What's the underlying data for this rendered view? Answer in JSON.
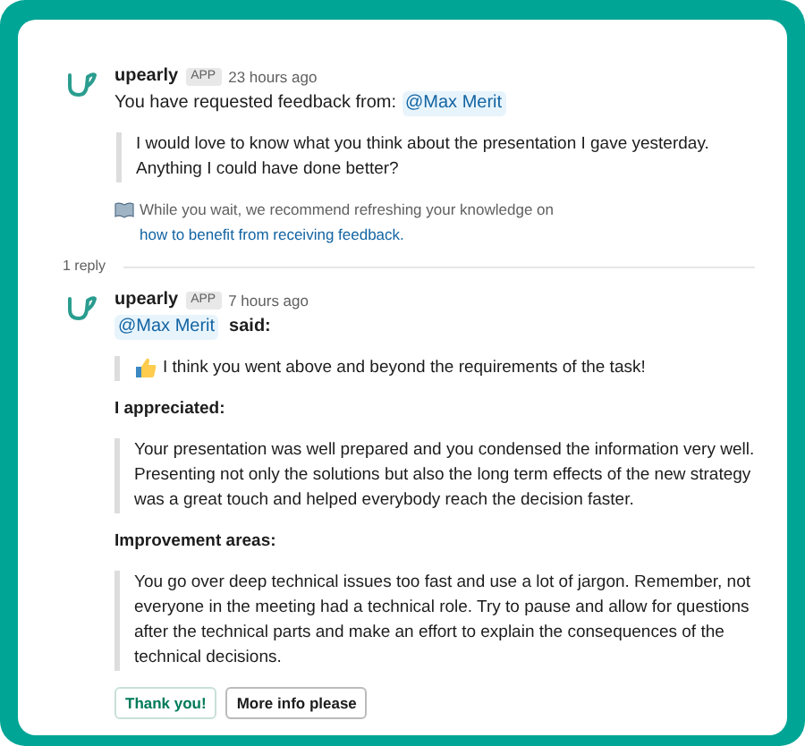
{
  "message": {
    "sender": "upearly",
    "badge": "APP",
    "time": "23 hours ago",
    "intro": "You have requested feedback from:",
    "mention": "@Max Merit",
    "quote": "I would love to know what you think about the presentation I gave yesterday. Anything I could have done better?",
    "tip": "While you wait, we recommend refreshing your knowledge on",
    "tip_link": "how to benefit from receiving feedback."
  },
  "replies_label": "1 reply",
  "reply": {
    "sender": "upearly",
    "badge": "APP",
    "time": "7 hours ago",
    "mention": "@Max Merit",
    "said": "said:",
    "blocks": [
      {
        "kind": "reaction_quote",
        "text": "I think you went above and beyond the requirements of the task!"
      },
      {
        "kind": "heading",
        "text": "I appreciated:"
      },
      {
        "kind": "quote",
        "text": "Your presentation was well prepared and you condensed the information very well. Presenting not only the solutions but also the long term effects of the new strategy was a great touch and helped everybody reach the decision faster."
      },
      {
        "kind": "heading",
        "text": "Improvement areas:"
      },
      {
        "kind": "quote",
        "text": "You go over deep technical issues too fast and use a lot of jargon. Remember, not everyone in the meeting had a technical role. Try to pause and allow for questions after the technical parts and make an effort to explain the consequences of the technical decisions."
      }
    ],
    "buttons": [
      {
        "label": "Thank you!",
        "kind": "primary"
      },
      {
        "label": "More info please",
        "kind": "default"
      }
    ]
  }
}
